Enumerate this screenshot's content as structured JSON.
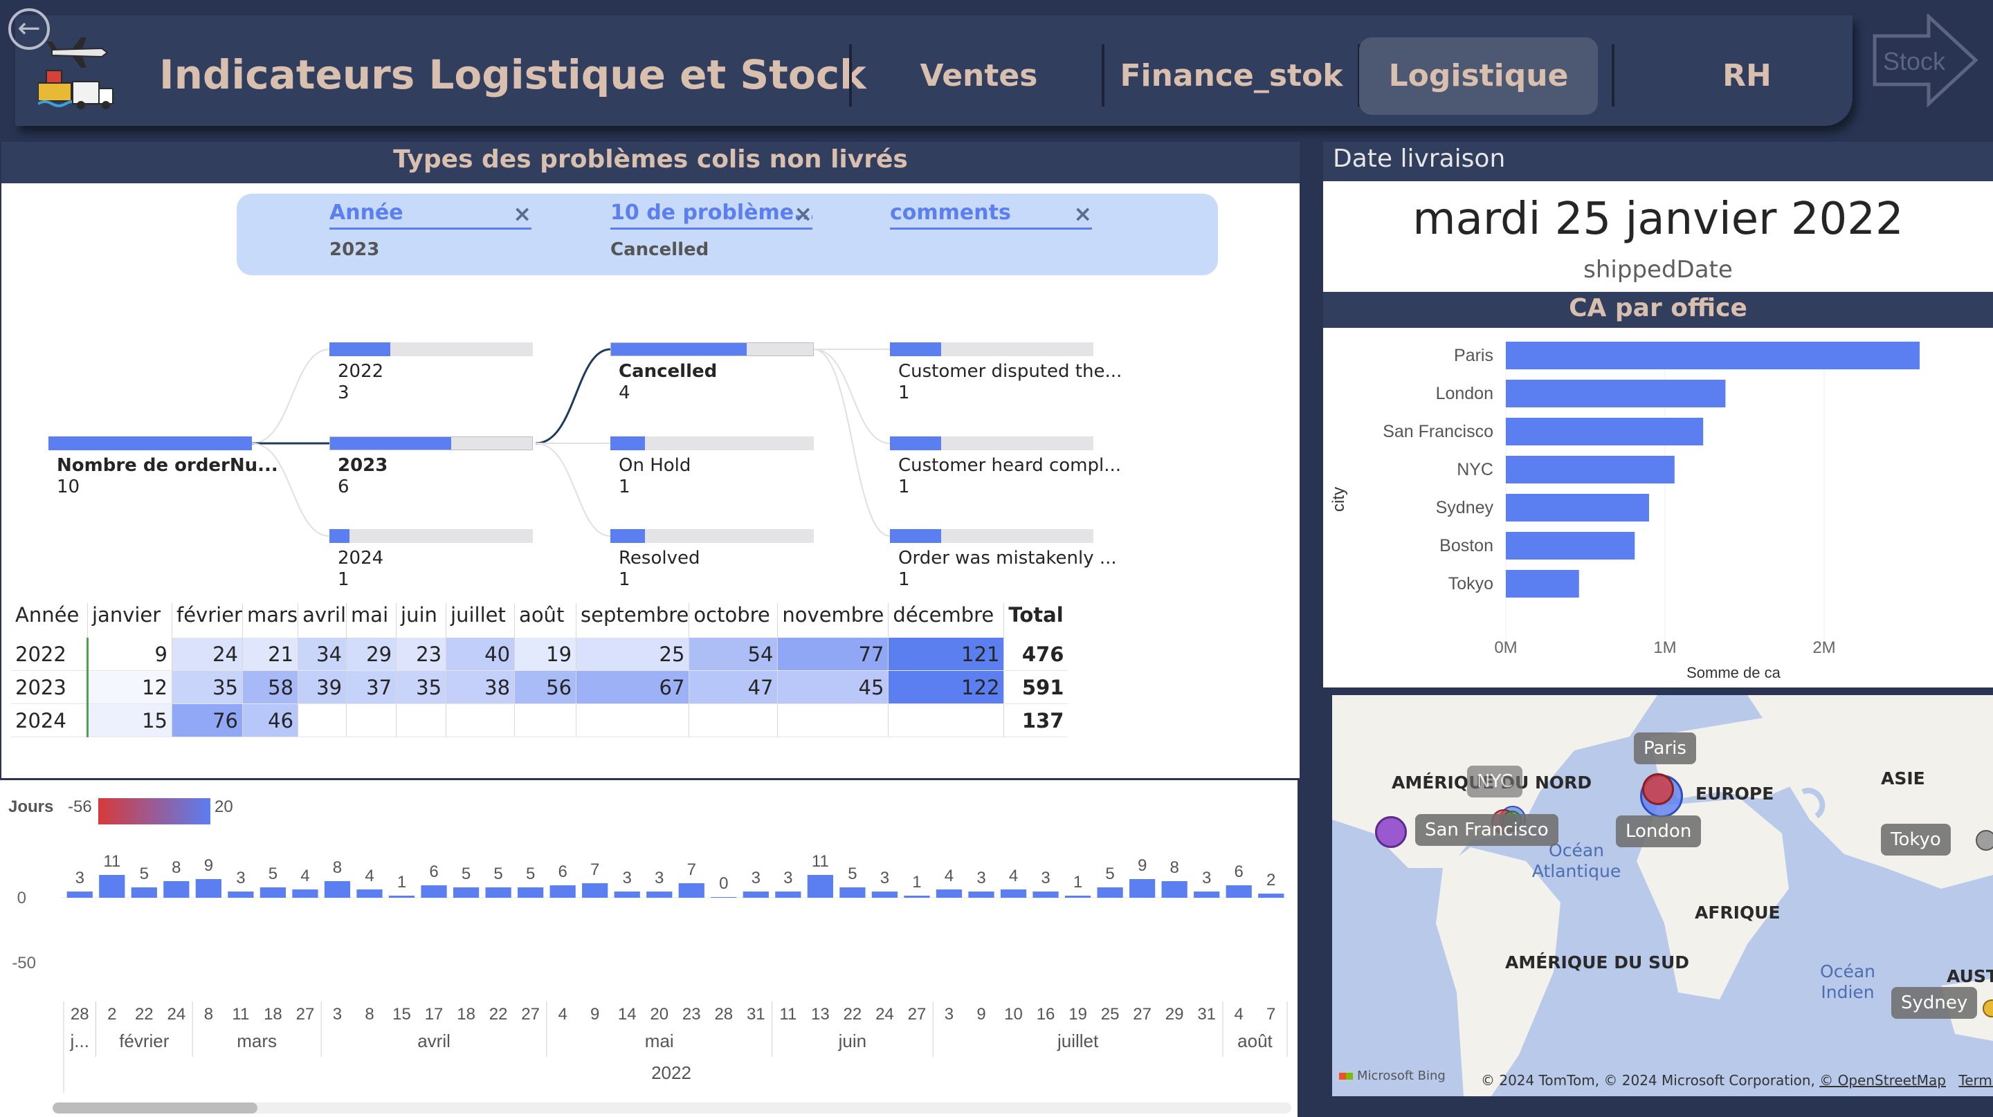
{
  "header": {
    "title": "Indicateurs Logistique et Stock",
    "nav": [
      "Ventes",
      "Finance_stok",
      "Logistique",
      "RH"
    ],
    "active_nav": "Logistique",
    "stock_label": "Stock"
  },
  "decomposition": {
    "title": "Types des problèmes colis non livrés",
    "filters": [
      {
        "label": "Année",
        "value": "2023"
      },
      {
        "label": "10 de problème...",
        "value": "Cancelled"
      },
      {
        "label": "comments",
        "value": ""
      }
    ],
    "root": {
      "label": "Nombre de orderNu...",
      "value": "10"
    },
    "years": [
      {
        "label": "2022",
        "value": "3",
        "fill": 0.3
      },
      {
        "label": "2023",
        "value": "6",
        "fill": 0.6
      },
      {
        "label": "2024",
        "value": "1",
        "fill": 0.1
      }
    ],
    "statuses": [
      {
        "label": "Cancelled",
        "value": "4",
        "fill": 0.67
      },
      {
        "label": "On Hold",
        "value": "1",
        "fill": 0.17
      },
      {
        "label": "Resolved",
        "value": "1",
        "fill": 0.17
      }
    ],
    "comments": [
      {
        "label": "Customer disputed the...",
        "value": "1",
        "fill": 0.25
      },
      {
        "label": "Customer heard compl...",
        "value": "1",
        "fill": 0.25
      },
      {
        "label": "Order was mistakenly ...",
        "value": "1",
        "fill": 0.25
      }
    ]
  },
  "matrix": {
    "headers": [
      "Année",
      "janvier",
      "février",
      "mars",
      "avril",
      "mai",
      "juin",
      "juillet",
      "août",
      "septembre",
      "octobre",
      "novembre",
      "décembre",
      "Total"
    ],
    "rows": [
      {
        "year": "2022",
        "values": [
          "9",
          "24",
          "21",
          "34",
          "29",
          "23",
          "40",
          "19",
          "25",
          "54",
          "77",
          "121"
        ],
        "total": "476"
      },
      {
        "year": "2023",
        "values": [
          "12",
          "35",
          "58",
          "39",
          "37",
          "35",
          "38",
          "56",
          "67",
          "47",
          "45",
          "122"
        ],
        "total": "591"
      },
      {
        "year": "2024",
        "values": [
          "15",
          "76",
          "46",
          "",
          "",
          "",
          "",
          "",
          "",
          "",
          "",
          ""
        ],
        "total": "137"
      }
    ]
  },
  "timeline": {
    "legend_title": "Jours",
    "legend_min": "-56",
    "legend_max": "20",
    "y_ticks": [
      "0",
      "-50"
    ],
    "values": [
      3,
      11,
      5,
      8,
      9,
      3,
      5,
      4,
      8,
      4,
      1,
      6,
      5,
      5,
      5,
      6,
      7,
      3,
      3,
      7,
      0,
      3,
      3,
      11,
      5,
      3,
      1,
      4,
      3,
      4,
      3,
      1,
      5,
      9,
      8,
      3,
      6,
      2
    ],
    "days": [
      "28",
      "2",
      "22",
      "24",
      "8",
      "11",
      "18",
      "27",
      "3",
      "8",
      "15",
      "17",
      "18",
      "22",
      "27",
      "4",
      "9",
      "14",
      "20",
      "23",
      "28",
      "31",
      "11",
      "13",
      "22",
      "24",
      "27",
      "3",
      "9",
      "10",
      "16",
      "19",
      "25",
      "27",
      "29",
      "31",
      "4",
      "7"
    ],
    "months": [
      {
        "label": "j...",
        "start": 0,
        "end": 0
      },
      {
        "label": "février",
        "start": 1,
        "end": 3
      },
      {
        "label": "mars",
        "start": 4,
        "end": 7
      },
      {
        "label": "avril",
        "start": 8,
        "end": 14
      },
      {
        "label": "mai",
        "start": 15,
        "end": 21
      },
      {
        "label": "juin",
        "start": 22,
        "end": 26
      },
      {
        "label": "juillet",
        "start": 27,
        "end": 35
      },
      {
        "label": "août",
        "start": 36,
        "end": 37
      }
    ],
    "year": "2022"
  },
  "date_card": {
    "title": "Date livraison",
    "value": "mardi 25 janvier 2022",
    "field": "shippedDate"
  },
  "chart_data": {
    "type": "bar",
    "orientation": "horizontal",
    "title": "CA par office",
    "categories": [
      "Paris",
      "London",
      "San Francisco",
      "NYC",
      "Sydney",
      "Boston",
      "Tokyo"
    ],
    "values": [
      2600000,
      1380000,
      1240000,
      1060000,
      900000,
      810000,
      460000
    ],
    "xlabel": "Somme de ca",
    "ylabel": "city",
    "x_ticks": [
      "0M",
      "1M",
      "2M"
    ],
    "xlim": [
      0,
      2800000
    ],
    "bar_color": "#5b7ef0"
  },
  "map": {
    "continents": [
      "AMÉRIQUE DU NORD",
      "EUROPE",
      "ASIE",
      "AFRIQUE",
      "AMÉRIQUE DU SUD",
      "AUST"
    ],
    "oceans": [
      "Océan Atlantique",
      "Océan Indien"
    ],
    "cities": [
      "Paris",
      "NYC",
      "San Francisco",
      "London",
      "Tokyo",
      "Sydney"
    ],
    "attribution": "© 2024 TomTom, © 2024 Microsoft Corporation,",
    "osm": "© OpenStreetMap",
    "terms": "Terms",
    "brand": "Microsoft Bing"
  },
  "colors": {
    "background": "#283452",
    "header": "#323e5e",
    "title": "#d9bfae",
    "accent": "#5b7ef0"
  }
}
